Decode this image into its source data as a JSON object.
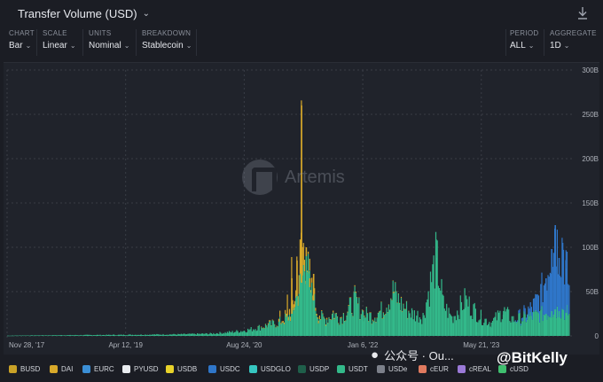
{
  "header": {
    "title": "Transfer Volume (USD)",
    "download_icon": "download-icon"
  },
  "controls": [
    {
      "label": "CHART",
      "value": "Bar"
    },
    {
      "label": "SCALE",
      "value": "Linear"
    },
    {
      "label": "UNITS",
      "value": "Nominal"
    },
    {
      "label": "BREAKDOWN",
      "value": "Stablecoin"
    },
    {
      "label": "PERIOD",
      "value": "ALL"
    },
    {
      "label": "AGGREGATE",
      "value": "1D"
    }
  ],
  "watermark": "Artemis",
  "overlay": {
    "wechat_text": "公众号 · Ou...",
    "author": "@BitKelly"
  },
  "colors": {
    "USDT": "#33b98a",
    "USDC": "#2f76c9",
    "DAI": "#d8a92a",
    "BUSD": "#c9a227",
    "grid": "#3a3d46",
    "axis_text": "#aeb2ba",
    "bg": "#20232b"
  },
  "chart_data": {
    "type": "bar",
    "title": "Transfer Volume (USD)",
    "stacked": true,
    "x_ticks": [
      "Nov 28, '17",
      "Apr 12, '19",
      "Aug 24, '20",
      "Jan 6, '22",
      "May 21, '23"
    ],
    "y_ticks": [
      "0",
      "50B",
      "100B",
      "150B",
      "200B",
      "250B",
      "300B"
    ],
    "ylim": [
      0,
      300
    ],
    "y_unit": "B",
    "grid": true,
    "legend_position": "bottom",
    "legend": [
      {
        "name": "BUSD",
        "color": "#c9a227"
      },
      {
        "name": "DAI",
        "color": "#d8a92a"
      },
      {
        "name": "EURC",
        "color": "#3b8fd6"
      },
      {
        "name": "PYUSD",
        "color": "#e9ecef"
      },
      {
        "name": "USDB",
        "color": "#e8d22a"
      },
      {
        "name": "USDC",
        "color": "#2f76c9"
      },
      {
        "name": "USDGLO",
        "color": "#36c6c0"
      },
      {
        "name": "USDP",
        "color": "#1f5f4a"
      },
      {
        "name": "USDT",
        "color": "#33b98a"
      },
      {
        "name": "USDe",
        "color": "#7c808a"
      },
      {
        "name": "cEUR",
        "color": "#e07a5f"
      },
      {
        "name": "cREAL",
        "color": "#9b7ad8"
      },
      {
        "name": "cUSD",
        "color": "#3fbf6f"
      }
    ],
    "points": [
      {
        "x": "2017-11-28",
        "usdt": 0.3,
        "usdc": 0,
        "dai": 0
      },
      {
        "x": "2018-04-01",
        "usdt": 0.6,
        "usdc": 0,
        "dai": 0
      },
      {
        "x": "2018-08-01",
        "usdt": 0.8,
        "usdc": 0,
        "dai": 0
      },
      {
        "x": "2018-12-01",
        "usdt": 1.0,
        "usdc": 0,
        "dai": 0
      },
      {
        "x": "2019-04-12",
        "usdt": 1.2,
        "usdc": 0,
        "dai": 0
      },
      {
        "x": "2019-08-01",
        "usdt": 1.5,
        "usdc": 0,
        "dai": 0
      },
      {
        "x": "2019-12-01",
        "usdt": 1.8,
        "usdc": 0,
        "dai": 0
      },
      {
        "x": "2020-04-01",
        "usdt": 2.5,
        "usdc": 0,
        "dai": 0
      },
      {
        "x": "2020-06-15",
        "usdt": 4,
        "usdc": 0,
        "dai": 0
      },
      {
        "x": "2020-08-24",
        "usdt": 6,
        "usdc": 0,
        "dai": 0
      },
      {
        "x": "2020-10-15",
        "usdt": 9,
        "usdc": 0,
        "dai": 0
      },
      {
        "x": "2020-12-01",
        "usdt": 12,
        "usdc": 0,
        "dai": 1
      },
      {
        "x": "2021-01-15",
        "usdt": 15,
        "usdc": 0,
        "dai": 3
      },
      {
        "x": "2021-02-20",
        "usdt": 20,
        "usdc": 0,
        "dai": 20
      },
      {
        "x": "2021-03-10",
        "usdt": 25,
        "usdc": 0,
        "dai": 40
      },
      {
        "x": "2021-04-01",
        "usdt": 45,
        "usdc": 0,
        "dai": 40
      },
      {
        "x": "2021-04-20",
        "usdt": 60,
        "usdc": 0,
        "dai": 200
      },
      {
        "x": "2021-05-10",
        "usdt": 90,
        "usdc": 0,
        "dai": 10
      },
      {
        "x": "2021-05-25",
        "usdt": 55,
        "usdc": 0,
        "dai": 10
      },
      {
        "x": "2021-06-10",
        "usdt": 40,
        "usdc": 0,
        "dai": 30
      },
      {
        "x": "2021-07-01",
        "usdt": 22,
        "usdc": 0,
        "dai": 5
      },
      {
        "x": "2021-08-01",
        "usdt": 18,
        "usdc": 0,
        "dai": 2
      },
      {
        "x": "2021-09-01",
        "usdt": 25,
        "usdc": 0,
        "dai": 2
      },
      {
        "x": "2021-10-01",
        "usdt": 20,
        "usdc": 0,
        "dai": 1
      },
      {
        "x": "2021-11-01",
        "usdt": 28,
        "usdc": 0,
        "dai": 1
      },
      {
        "x": "2021-12-01",
        "usdt": 40,
        "usdc": 0,
        "dai": 1
      },
      {
        "x": "2022-01-06",
        "usdt": 25,
        "usdc": 0,
        "dai": 1
      },
      {
        "x": "2022-02-15",
        "usdt": 22,
        "usdc": 0,
        "dai": 1
      },
      {
        "x": "2022-04-01",
        "usdt": 30,
        "usdc": 0,
        "dai": 1
      },
      {
        "x": "2022-05-12",
        "usdt": 50,
        "usdc": 0,
        "dai": 1
      },
      {
        "x": "2022-06-15",
        "usdt": 35,
        "usdc": 0,
        "dai": 1
      },
      {
        "x": "2022-08-01",
        "usdt": 25,
        "usdc": 0,
        "dai": 0
      },
      {
        "x": "2022-09-15",
        "usdt": 22,
        "usdc": 0,
        "dai": 0
      },
      {
        "x": "2022-11-10",
        "usdt": 88,
        "usdc": 0,
        "dai": 0
      },
      {
        "x": "2022-12-10",
        "usdt": 35,
        "usdc": 0,
        "dai": 0
      },
      {
        "x": "2023-01-15",
        "usdt": 20,
        "usdc": 0,
        "dai": 0
      },
      {
        "x": "2023-03-11",
        "usdt": 40,
        "usdc": 0,
        "dai": 0
      },
      {
        "x": "2023-05-21",
        "usdt": 20,
        "usdc": 0,
        "dai": 0
      },
      {
        "x": "2023-07-01",
        "usdt": 15,
        "usdc": 0,
        "dai": 0
      },
      {
        "x": "2023-08-20",
        "usdt": 28,
        "usdc": 0,
        "dai": 0
      },
      {
        "x": "2023-10-01",
        "usdt": 18,
        "usdc": 0,
        "dai": 0
      },
      {
        "x": "2023-11-15",
        "usdt": 20,
        "usdc": 5,
        "dai": 0
      },
      {
        "x": "2023-12-20",
        "usdt": 22,
        "usdc": 10,
        "dai": 0
      },
      {
        "x": "2024-01-20",
        "usdt": 24,
        "usdc": 20,
        "dai": 0
      },
      {
        "x": "2024-02-15",
        "usdt": 25,
        "usdc": 40,
        "dai": 0
      },
      {
        "x": "2024-03-10",
        "usdt": 28,
        "usdc": 70,
        "dai": 0
      },
      {
        "x": "2024-03-25",
        "usdt": 30,
        "usdc": 95,
        "dai": 0
      },
      {
        "x": "2024-04-10",
        "usdt": 28,
        "usdc": 60,
        "dai": 0
      },
      {
        "x": "2024-04-25",
        "usdt": 30,
        "usdc": 75,
        "dai": 0
      },
      {
        "x": "2024-05-10",
        "usdt": 26,
        "usdc": 50,
        "dai": 0
      },
      {
        "x": "2024-05-25",
        "usdt": 25,
        "usdc": 30,
        "dai": 0
      }
    ]
  }
}
